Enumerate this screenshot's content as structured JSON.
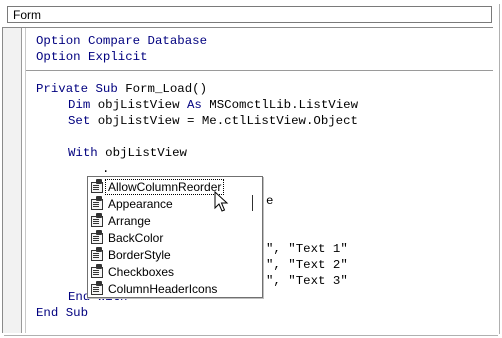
{
  "object_combo": {
    "value": "Form"
  },
  "code": {
    "line1a": "Option Compare Database",
    "line2a": "Option Explicit",
    "sub_kw": "Private Sub",
    "sub_name": " Form_Load()",
    "dim_kw": "Dim",
    "dim_var": " objListView ",
    "as_kw": "As",
    "dim_type": " MSComctlLib.ListView",
    "set_kw": "Set",
    "set_rest": " objListView = Me.ctlListView.Object",
    "with_kw": "With",
    "with_rest": " objListView",
    "dot_line": ".",
    "partial_e": "e",
    "str1": "\", \"Text 1\"",
    "str2": "\", \"Text 2\"",
    "str3": "\", \"Text 3\"",
    "endwith_visible": "End With",
    "endsub": "End Sub"
  },
  "intellisense": {
    "items": [
      {
        "label": "AllowColumnReorder",
        "icon": "property-icon",
        "selected": true
      },
      {
        "label": "Appearance",
        "icon": "property-icon",
        "selected": false
      },
      {
        "label": "Arrange",
        "icon": "property-icon",
        "selected": false
      },
      {
        "label": "BackColor",
        "icon": "property-icon",
        "selected": false
      },
      {
        "label": "BorderStyle",
        "icon": "property-icon",
        "selected": false
      },
      {
        "label": "Checkboxes",
        "icon": "property-icon",
        "selected": false
      },
      {
        "label": "ColumnHeaderIcons",
        "icon": "property-icon",
        "selected": false
      }
    ]
  },
  "colors": {
    "keyword": "#00007f",
    "text": "#000000"
  }
}
